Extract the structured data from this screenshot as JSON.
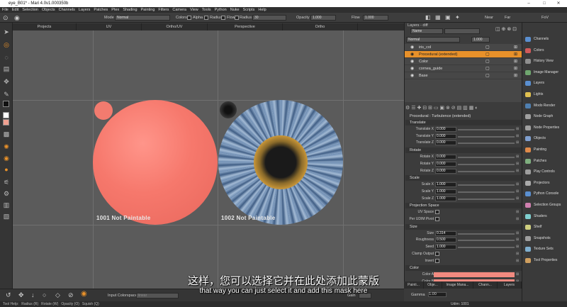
{
  "window": {
    "title": "eye_B01* - Mari 4.0v1.000350b"
  },
  "menu": [
    "File",
    "Edit",
    "Selection",
    "Objects",
    "Channels",
    "Layers",
    "Patches",
    "Ptex",
    "Shading",
    "Painting",
    "Filters",
    "Camera",
    "View",
    "Tools",
    "Python",
    "Nuke",
    "Scripts",
    "Help"
  ],
  "toolopts": {
    "mode_label": "Mode",
    "mode_value": "Normal",
    "colors_label": "Colors",
    "alpha_label": "Alpha",
    "radius_label": "Radius",
    "flow_label": "Flow",
    "radius2_label": "Radius",
    "radius_value": "30",
    "opacity_label": "Opacity",
    "opacity_value": "1.000",
    "flow2_label": "Flow",
    "flow_value": "1.000",
    "near_label": "Near",
    "far_label": "Far",
    "fov_label": "FoV"
  },
  "viewtabs": [
    "Projects",
    "UV",
    "Ortho/UV",
    "Perspective",
    "Ortho"
  ],
  "viewport": {
    "udim1": "1001 Not Paintable",
    "udim2": "1002 Not Paintable"
  },
  "subtitles": {
    "cn": "这样，您可以选择它并在此处添加此蒙版",
    "en": "that way you can just select it and add this mask here"
  },
  "bottombar": {
    "colorspace_label": "Input Colorspace",
    "colorspace_value": "linear",
    "gain_label": "Gain",
    "gamma_label": "Gamma",
    "gamma_value": "1.00",
    "udim_label": "Udim: 1001"
  },
  "statusbar": [
    "Tool Help:",
    "Radius (R)",
    "Rotate (W)",
    "Opacity (O)",
    "Squish (Q)"
  ],
  "layers": {
    "header": "Layers - diff",
    "filter_label": "Name",
    "blend_mode": "Normal",
    "opacity": "1.000",
    "rows": [
      {
        "name": "iris_col",
        "selected": false
      },
      {
        "name": "Procedural (extended)",
        "selected": true
      },
      {
        "name": "Color",
        "selected": false
      },
      {
        "name": "cornea_guide",
        "selected": false
      },
      {
        "name": "Base",
        "selected": false
      }
    ]
  },
  "properties": {
    "header": "Procedural : Turbulence (extended)",
    "translate": {
      "title": "Translate",
      "rows": [
        [
          "Translate X",
          "0.000"
        ],
        [
          "Translate Y",
          "0.000"
        ],
        [
          "Translate Z",
          "0.000"
        ]
      ]
    },
    "rotate": {
      "title": "Rotate",
      "rows": [
        [
          "Rotate X",
          "0.000"
        ],
        [
          "Rotate Y",
          "0.000"
        ],
        [
          "Rotate Z",
          "0.000"
        ]
      ]
    },
    "scale": {
      "title": "Scale",
      "rows": [
        [
          "Scale X",
          "1.000"
        ],
        [
          "Scale Y",
          "1.000"
        ],
        [
          "Scale Z",
          "1.000"
        ]
      ]
    },
    "projection": {
      "title": "Projection Space",
      "rows": [
        [
          "UV Space",
          ""
        ],
        [
          "Per UDIM Pivot",
          ""
        ]
      ]
    },
    "size": {
      "title": "Size",
      "rows": [
        [
          "Size",
          "0.314"
        ],
        [
          "Roughness",
          "0.500"
        ],
        [
          "Seed",
          "1.000"
        ],
        [
          "Clamp Output",
          ""
        ],
        [
          "Invert",
          ""
        ]
      ]
    },
    "color": {
      "title": "Color",
      "rows": [
        [
          "Color A",
          ""
        ],
        [
          "Color B",
          ""
        ]
      ]
    },
    "swatch_color": "#f28a80"
  },
  "panel_tabs": [
    "Painti...",
    "Obje...",
    "Image Mana...",
    "Chann...",
    "Layers"
  ],
  "palettes": [
    {
      "label": "Channels",
      "color": "#5a8fd0"
    },
    {
      "label": "Colors",
      "color": "#d05a5a"
    },
    {
      "label": "History View",
      "color": "#8f8f8f"
    },
    {
      "label": "Image Manager",
      "color": "#6fa66f"
    },
    {
      "label": "Layers",
      "color": "#5a8fd0"
    },
    {
      "label": "Lights",
      "color": "#e0c050"
    },
    {
      "label": "Modo Render",
      "color": "#4f7fb0"
    },
    {
      "label": "Node Graph",
      "color": "#9f9f9f"
    },
    {
      "label": "Node Properties",
      "color": "#9f9f9f"
    },
    {
      "label": "Objects",
      "color": "#7f9fcf"
    },
    {
      "label": "Painting",
      "color": "#e08a4a"
    },
    {
      "label": "Patches",
      "color": "#7faf7f"
    },
    {
      "label": "Play Controls",
      "color": "#9f9f9f"
    },
    {
      "label": "Projectors",
      "color": "#aaaaaa"
    },
    {
      "label": "Python Console",
      "color": "#5a8fd0"
    },
    {
      "label": "Selection Groups",
      "color": "#cf7faf"
    },
    {
      "label": "Shaders",
      "color": "#7fcfcf"
    },
    {
      "label": "Shelf",
      "color": "#cfcf7f"
    },
    {
      "label": "Snapshots",
      "color": "#9f9f9f"
    },
    {
      "label": "Texture Sets",
      "color": "#7fafcf"
    },
    {
      "label": "Tool Properties",
      "color": "#cf9f5f"
    }
  ]
}
